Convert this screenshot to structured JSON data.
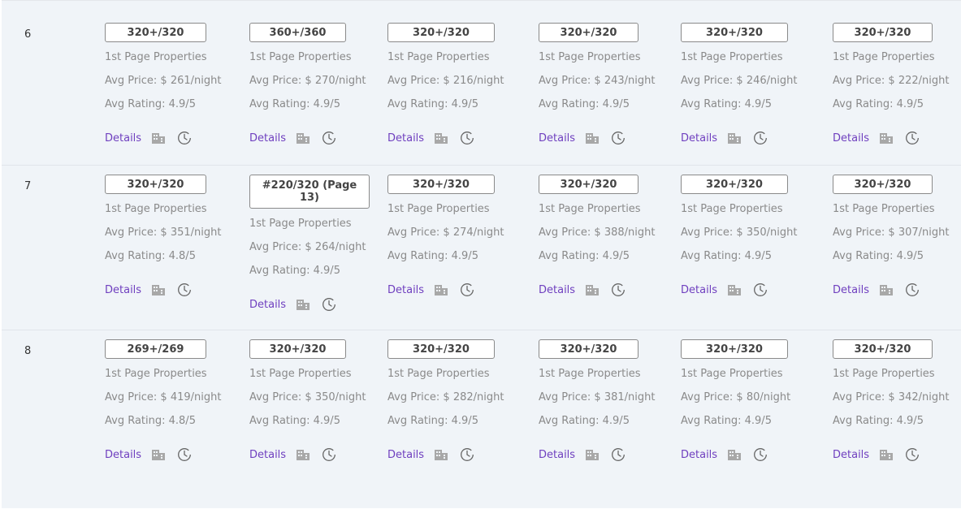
{
  "labels": {
    "first_page": "1st Page Properties",
    "details": "Details"
  },
  "rows": [
    {
      "num": "6",
      "cells": [
        {
          "rank": "320+/320",
          "price": "Avg Price: $ 261/night",
          "rating": "Avg Rating: 4.9/5"
        },
        {
          "rank": "360+/360",
          "price": "Avg Price: $ 270/night",
          "rating": "Avg Rating: 4.9/5"
        },
        {
          "rank": "320+/320",
          "price": "Avg Price: $ 216/night",
          "rating": "Avg Rating: 4.9/5"
        },
        {
          "rank": "320+/320",
          "price": "Avg Price: $ 243/night",
          "rating": "Avg Rating: 4.9/5"
        },
        {
          "rank": "320+/320",
          "price": "Avg Price: $ 246/night",
          "rating": "Avg Rating: 4.9/5"
        },
        {
          "rank": "320+/320",
          "price": "Avg Price: $ 222/night",
          "rating": "Avg Rating: 4.9/5"
        }
      ]
    },
    {
      "num": "7",
      "cells": [
        {
          "rank": "320+/320",
          "price": "Avg Price: $ 351/night",
          "rating": "Avg Rating: 4.8/5"
        },
        {
          "rank": "#220/320 (Page 13)",
          "price": "Avg Price: $ 264/night",
          "rating": "Avg Rating: 4.9/5"
        },
        {
          "rank": "320+/320",
          "price": "Avg Price: $ 274/night",
          "rating": "Avg Rating: 4.9/5"
        },
        {
          "rank": "320+/320",
          "price": "Avg Price: $ 388/night",
          "rating": "Avg Rating: 4.9/5"
        },
        {
          "rank": "320+/320",
          "price": "Avg Price: $ 350/night",
          "rating": "Avg Rating: 4.9/5"
        },
        {
          "rank": "320+/320",
          "price": "Avg Price: $ 307/night",
          "rating": "Avg Rating: 4.9/5"
        }
      ]
    },
    {
      "num": "8",
      "cells": [
        {
          "rank": "269+/269",
          "price": "Avg Price: $ 419/night",
          "rating": "Avg Rating: 4.8/5"
        },
        {
          "rank": "320+/320",
          "price": "Avg Price: $ 350/night",
          "rating": "Avg Rating: 4.9/5"
        },
        {
          "rank": "320+/320",
          "price": "Avg Price: $ 282/night",
          "rating": "Avg Rating: 4.9/5"
        },
        {
          "rank": "320+/320",
          "price": "Avg Price: $ 381/night",
          "rating": "Avg Rating: 4.9/5"
        },
        {
          "rank": "320+/320",
          "price": "Avg Price: $ 80/night",
          "rating": "Avg Rating: 4.9/5"
        },
        {
          "rank": "320+/320",
          "price": "Avg Price: $ 342/night",
          "rating": "Avg Rating: 4.9/5"
        }
      ]
    }
  ],
  "icons": {
    "building": "building-icon",
    "history": "history-icon"
  },
  "colors": {
    "link": "#6f3fbf",
    "muted": "#8a8a8a",
    "background": "#f0f4f8"
  }
}
